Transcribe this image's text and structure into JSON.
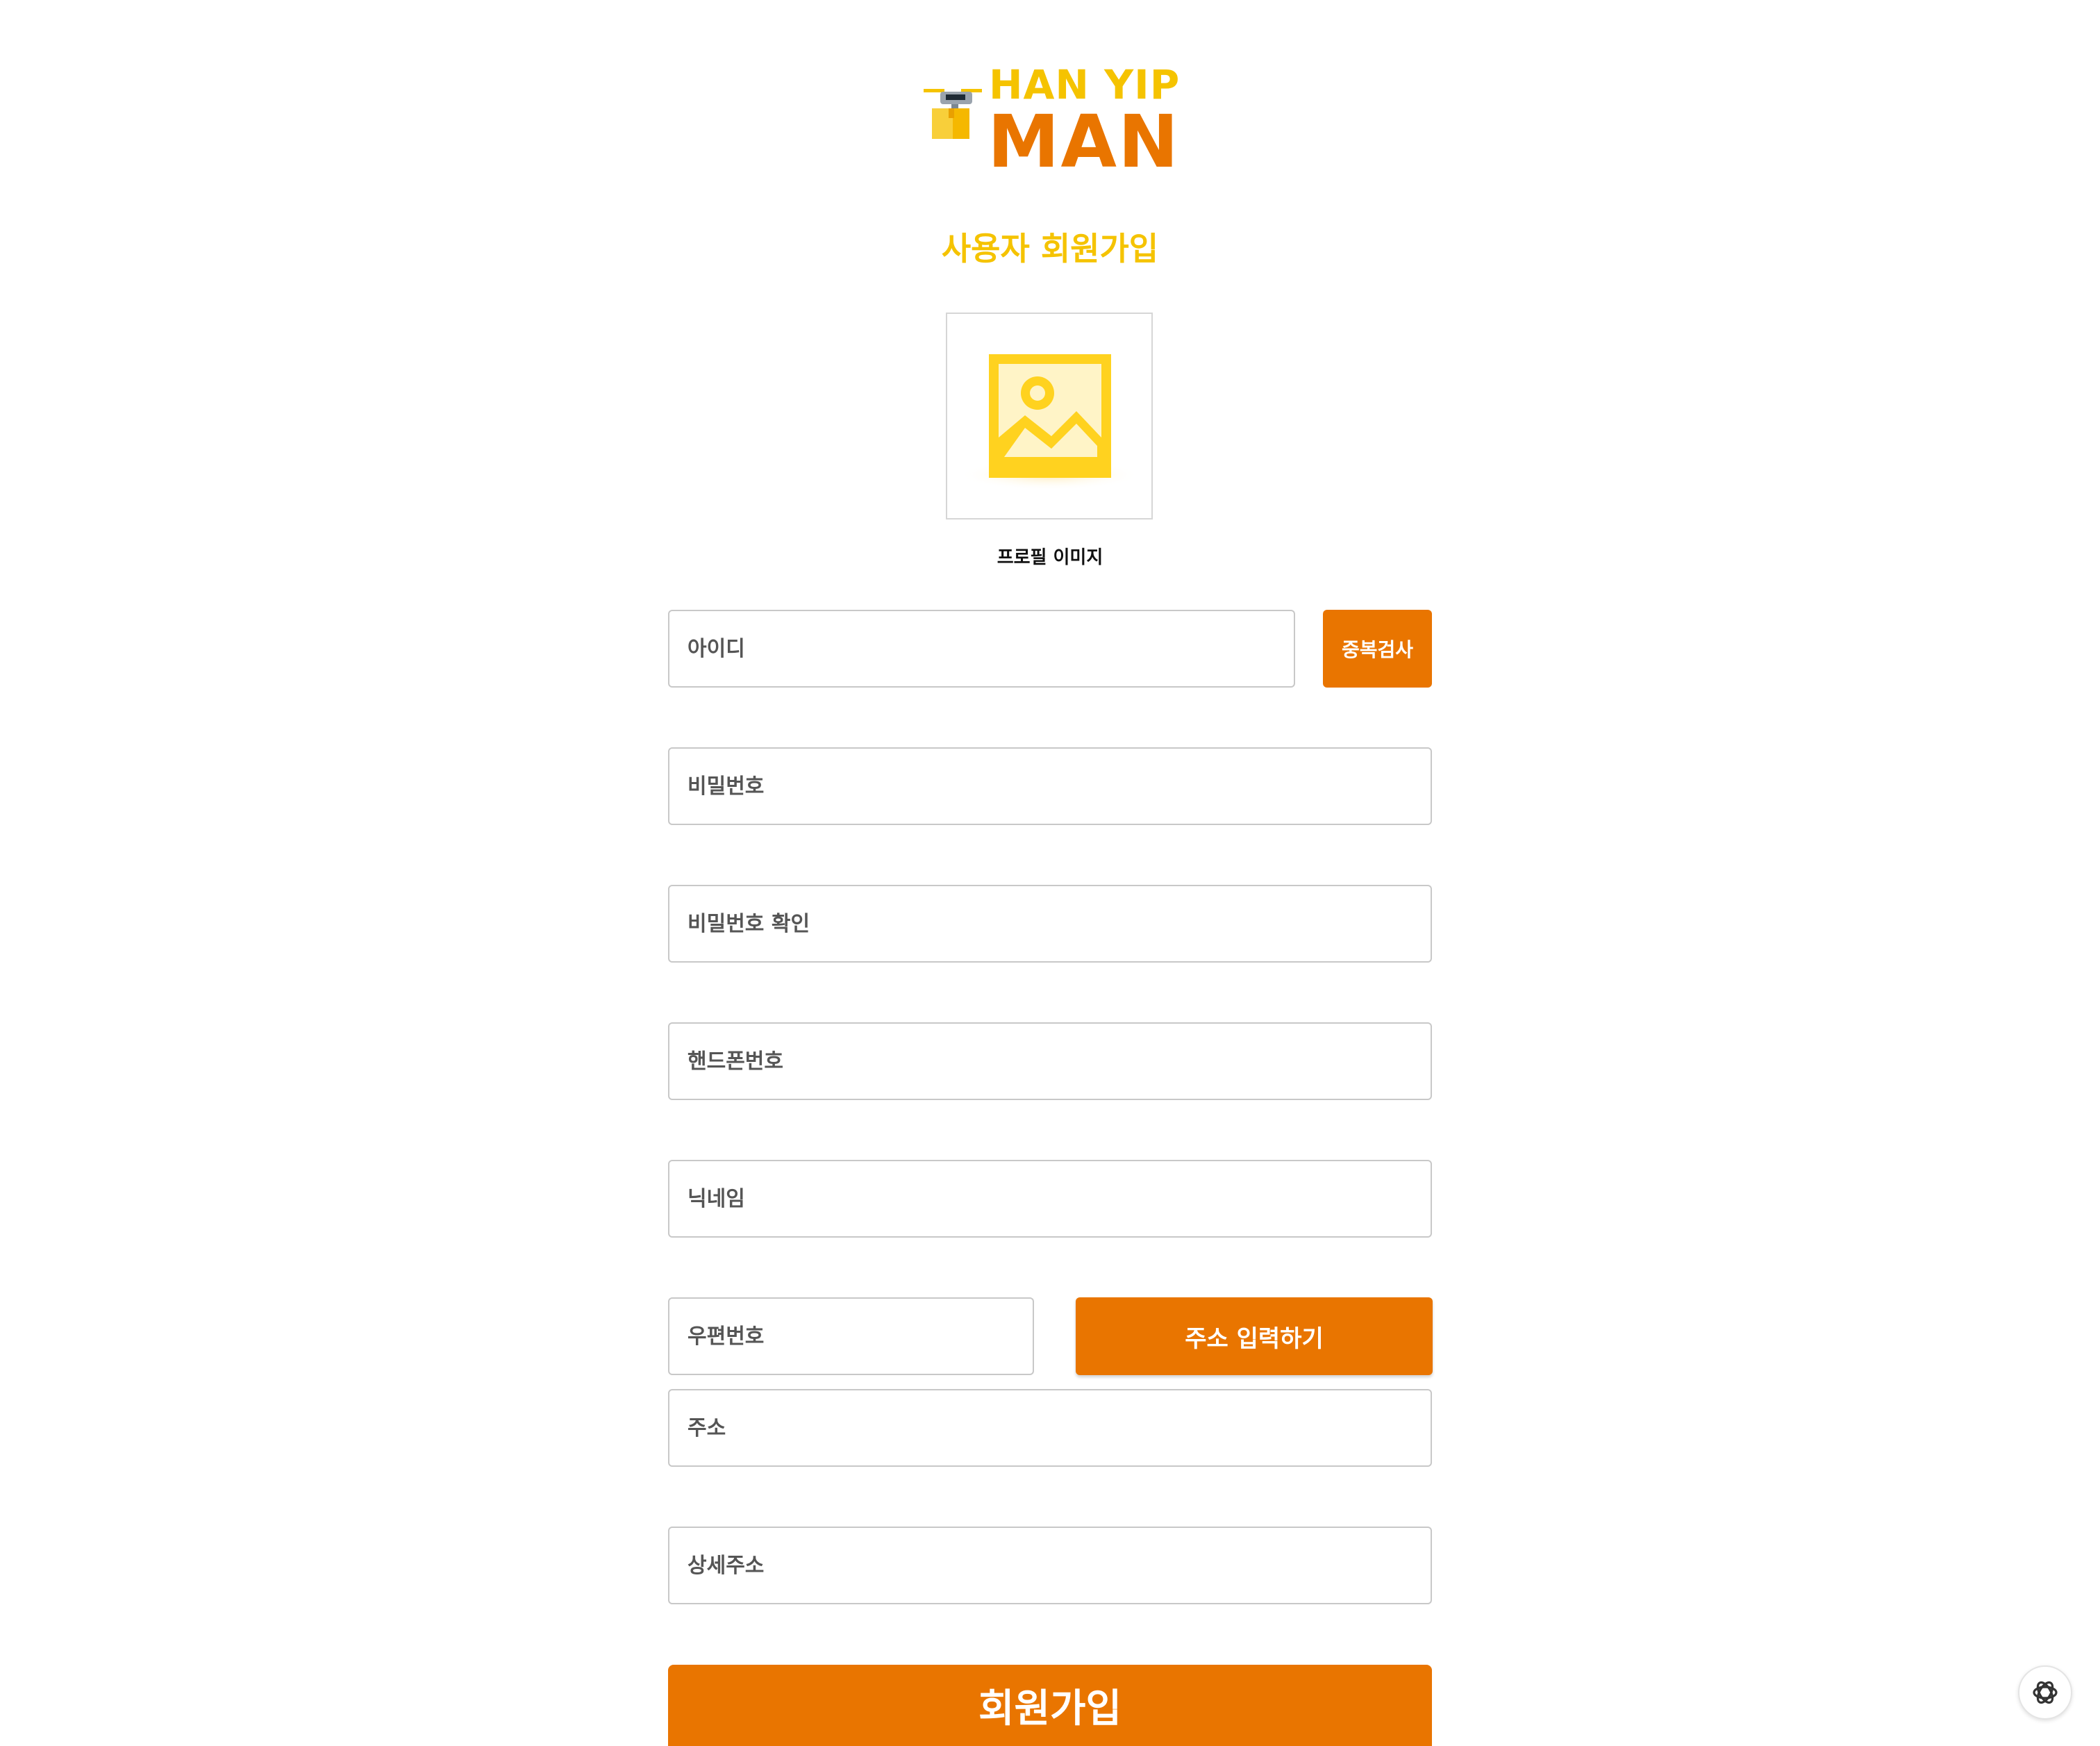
{
  "brand": {
    "line1": "HAN YIP",
    "line2": "MAN",
    "colors": {
      "yellow": "#f5c300",
      "orange": "#e97500"
    }
  },
  "page": {
    "title": "사용자 회원가입"
  },
  "profile": {
    "label": "프로필 이미지",
    "icon": "image-placeholder-icon"
  },
  "form": {
    "id_placeholder": "아이디",
    "duplicate_check_label": "중복검사",
    "password_placeholder": "비밀번호",
    "password_confirm_placeholder": "비밀번호 확인",
    "phone_placeholder": "핸드폰번호",
    "nickname_placeholder": "닉네임",
    "zipcode_placeholder": "우편번호",
    "address_search_label": "주소 입력하기",
    "address_placeholder": "주소",
    "address_detail_placeholder": "상세주소",
    "submit_label": "회원가입"
  },
  "assistant": {
    "icon": "assistant-icon"
  }
}
